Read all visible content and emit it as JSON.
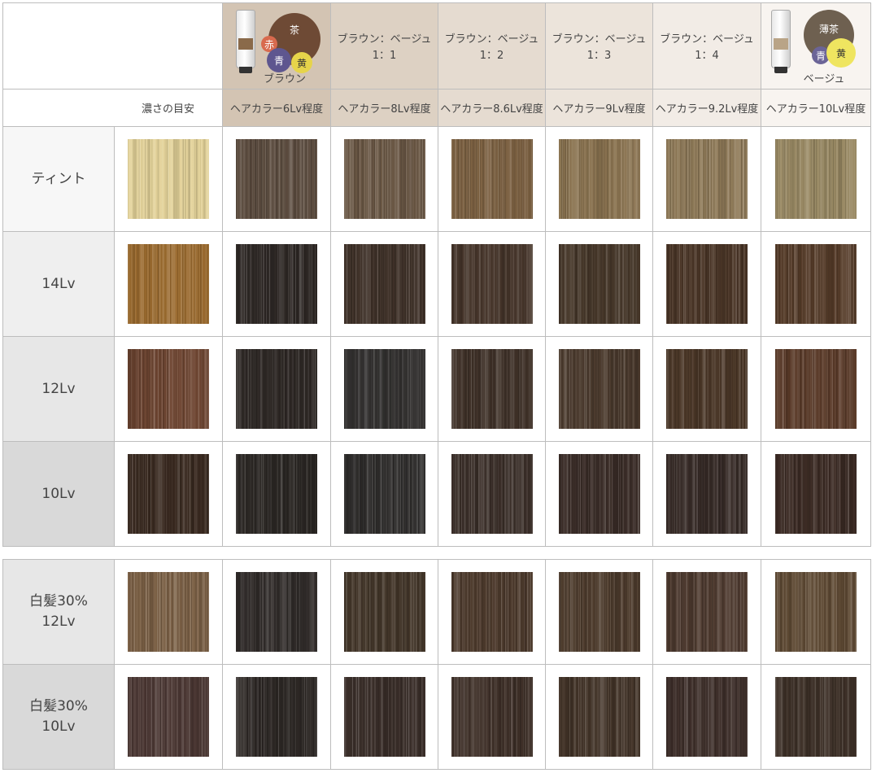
{
  "header": {
    "density_label": "濃さの目安",
    "columns": [
      {
        "name": "ブラウン",
        "level": "ヘアカラー6Lv程度",
        "bg": "#d3c4b3",
        "level_bg": "#d3c4b3",
        "kind": "product-brown",
        "circles": {
          "main": "茶",
          "a": "赤",
          "b": "青",
          "c": "黄"
        }
      },
      {
        "name": "ブラウン：ベージュ\n1：1",
        "level": "ヘアカラー8Lv程度",
        "bg": "#ddd1c3",
        "level_bg": "#ddd1c3",
        "kind": "text"
      },
      {
        "name": "ブラウン：ベージュ\n1：2",
        "level": "ヘアカラー8.6Lv程度",
        "bg": "#e5dbd0",
        "level_bg": "#e5dbd0",
        "kind": "text"
      },
      {
        "name": "ブラウン：ベージュ\n1：3",
        "level": "ヘアカラー9Lv程度",
        "bg": "#ece4db",
        "level_bg": "#ece4db",
        "kind": "text"
      },
      {
        "name": "ブラウン：ベージュ\n1：4",
        "level": "ヘアカラー9.2Lv程度",
        "bg": "#f2ece6",
        "level_bg": "#f2ece6",
        "kind": "text"
      },
      {
        "name": "ベージュ",
        "level": "ヘアカラー10Lv程度",
        "bg": "#f8f4f0",
        "level_bg": "#f8f4f0",
        "kind": "product-beige",
        "circles": {
          "main": "薄茶",
          "b": "青",
          "c": "黄"
        }
      }
    ]
  },
  "rows": [
    {
      "label": "ティント",
      "bg": "#f7f7f7",
      "colors": [
        "#e3d299",
        "#5c4c3f",
        "#6a5744",
        "#7c6142",
        "#8a7350",
        "#8f7a58",
        "#9a8a64"
      ]
    },
    {
      "label": "14Lv",
      "bg": "#efefef",
      "colors": [
        "#9a6a2e",
        "#2f2926",
        "#403229",
        "#46352a",
        "#463729",
        "#4a3526",
        "#553b28"
      ]
    },
    {
      "label": "12Lv",
      "bg": "#e7e7e7",
      "colors": [
        "#6e4531",
        "#2e2825",
        "#343231",
        "#3f3128",
        "#4b3a2d",
        "#4a3626",
        "#5a3a28"
      ]
    },
    {
      "label": "10Lv",
      "bg": "#d9d9d9",
      "colors": [
        "#3a2a20",
        "#2a2623",
        "#2e2c2b",
        "#3a2e28",
        "#3a2c27",
        "#362a26",
        "#3c2b24"
      ]
    },
    {
      "label": "白髪30%\n12Lv",
      "bg": "#e7e7e7",
      "colors": [
        "#7b6045",
        "#302b29",
        "#433629",
        "#4d3a2c",
        "#4e3c2d",
        "#4f3b30",
        "#5f4a34"
      ]
    },
    {
      "label": "白髪30%\n10Lv",
      "bg": "#d9d9d9",
      "colors": [
        "#4b3733",
        "#2c2724",
        "#3b2f2a",
        "#3e2f27",
        "#433428",
        "#3e2f2a",
        "#3d3027"
      ]
    }
  ]
}
